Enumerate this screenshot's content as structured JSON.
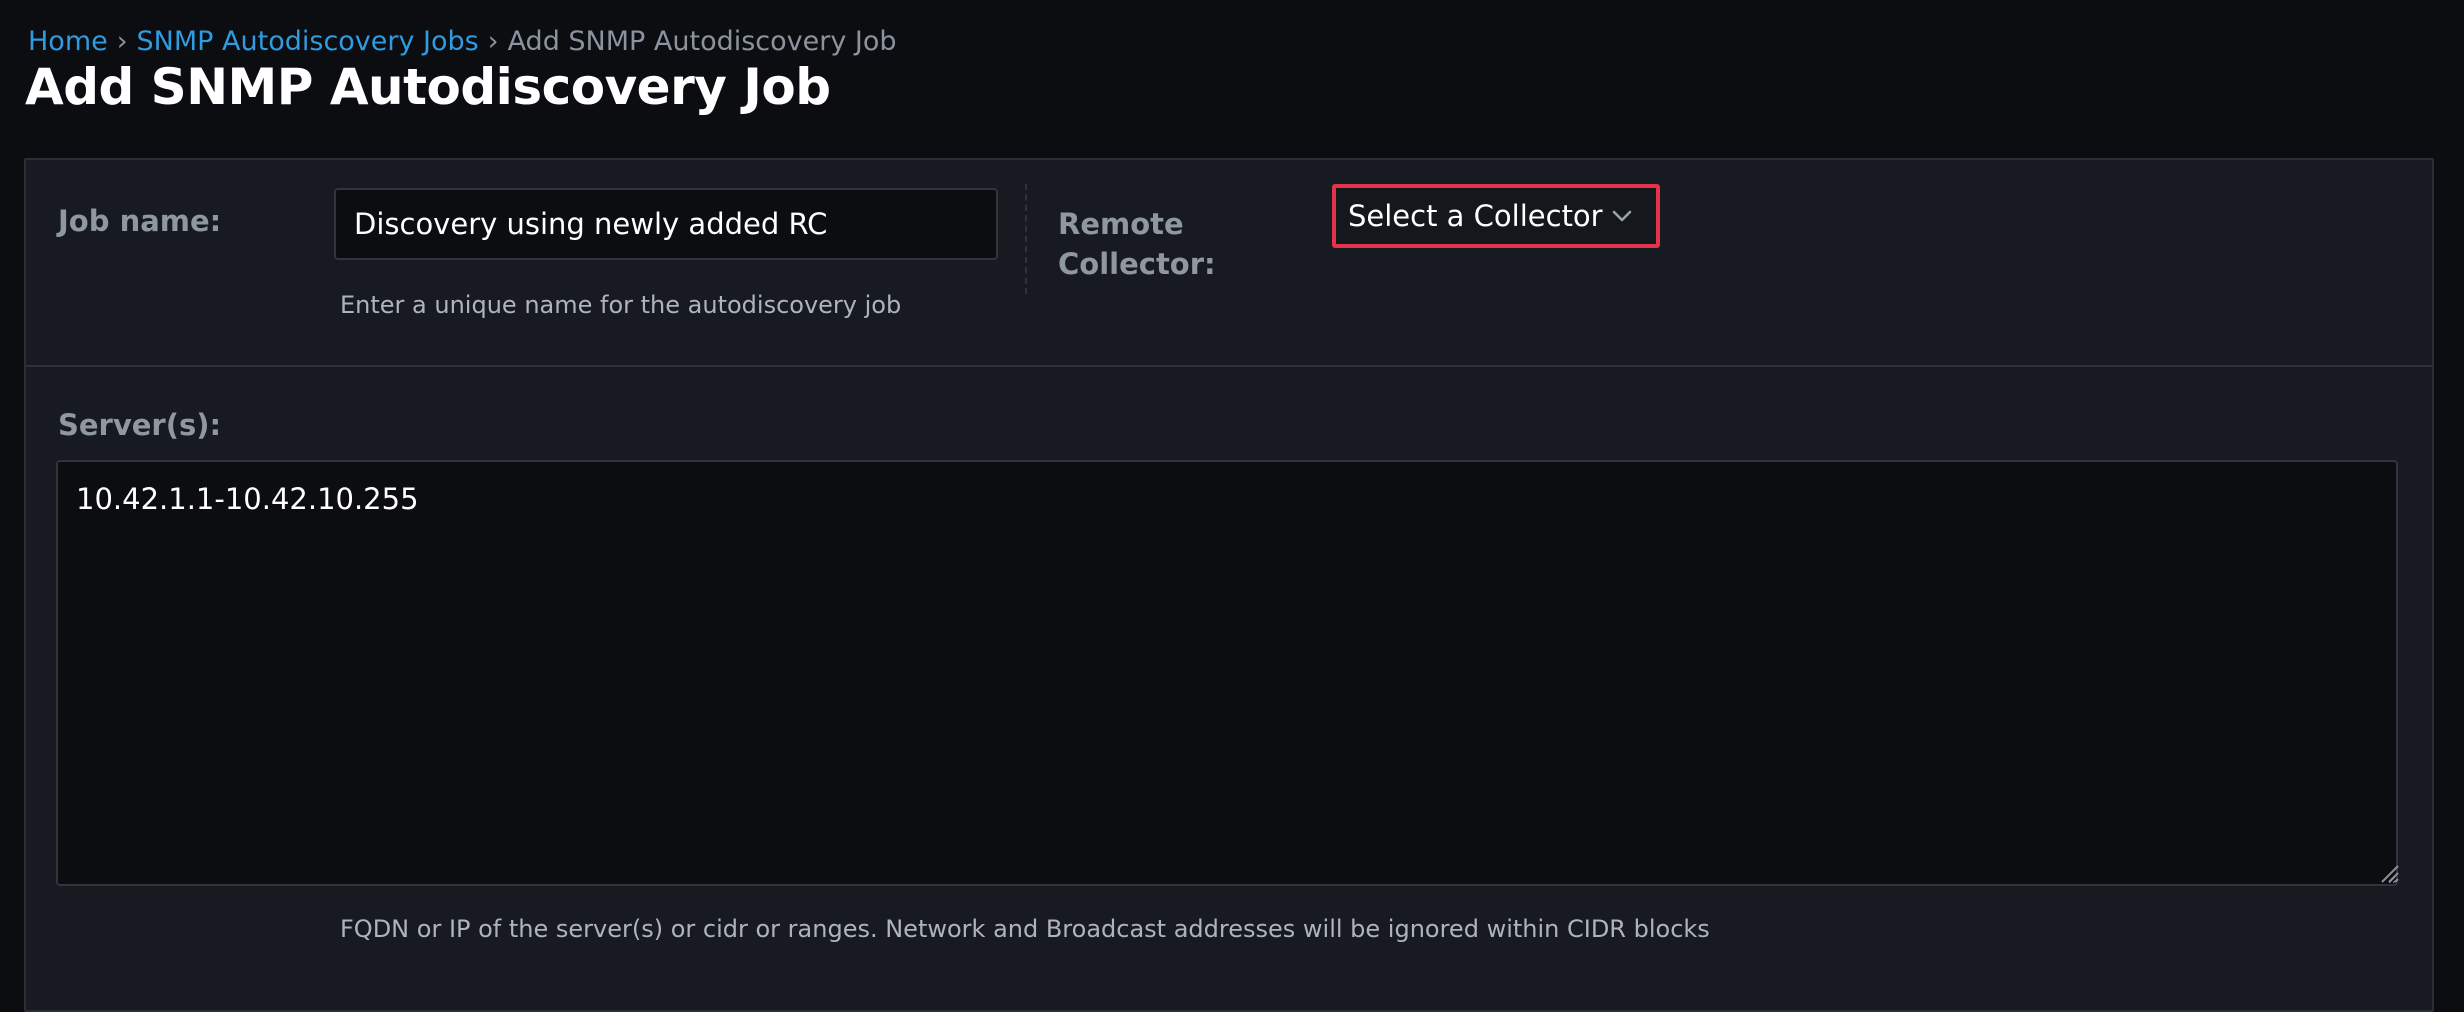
{
  "breadcrumb": {
    "home": "Home",
    "separator": "›",
    "jobs": "SNMP Autodiscovery Jobs",
    "current": "Add SNMP Autodiscovery Job"
  },
  "page": {
    "title": "Add SNMP Autodiscovery Job"
  },
  "form": {
    "job_name": {
      "label": "Job name:",
      "value": "Discovery using newly added RC",
      "help": "Enter a unique name for the autodiscovery job"
    },
    "remote_collector": {
      "label": "Remote Collector:",
      "selected": "Select a Collector"
    },
    "servers": {
      "label": "Server(s):",
      "value": "10.42.1.1-10.42.10.255",
      "help": "FQDN or IP of the server(s) or cidr or ranges. Network and Broadcast addresses will be ignored within CIDR blocks"
    }
  },
  "icons": {
    "dropdown": "chevron-down-icon",
    "resize": "resize-grip-icon"
  },
  "colors": {
    "link": "#2f9be0",
    "highlight": "#e4324a",
    "background": "#0b0d11",
    "panel": "#171b21"
  }
}
